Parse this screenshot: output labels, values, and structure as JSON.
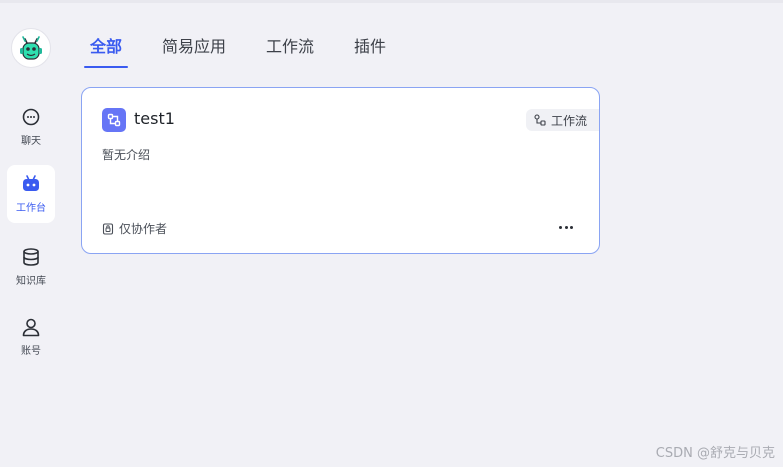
{
  "sidebar": {
    "avatar_icon": "robot-logo-icon",
    "items": [
      {
        "label": "聊天",
        "icon": "chat-bubble-icon",
        "active": false
      },
      {
        "label": "工作台",
        "icon": "robot-icon",
        "active": true
      },
      {
        "label": "知识库",
        "icon": "database-icon",
        "active": false
      },
      {
        "label": "账号",
        "icon": "user-icon",
        "active": false
      }
    ]
  },
  "tabs": [
    {
      "label": "全部",
      "active": true
    },
    {
      "label": "简易应用",
      "active": false
    },
    {
      "label": "工作流",
      "active": false
    },
    {
      "label": "插件",
      "active": false
    }
  ],
  "cards": [
    {
      "title": "test1",
      "type_label": "工作流",
      "description": "暂无介绍",
      "permission": "仅协作者",
      "icon": "workflow-app-icon"
    }
  ],
  "watermark": "CSDN @舒克与贝克",
  "colors": {
    "accent": "#3a5bf0",
    "card_border": "#8aa4f3",
    "background": "#f1f1f6",
    "app_icon": "#6675f6"
  }
}
